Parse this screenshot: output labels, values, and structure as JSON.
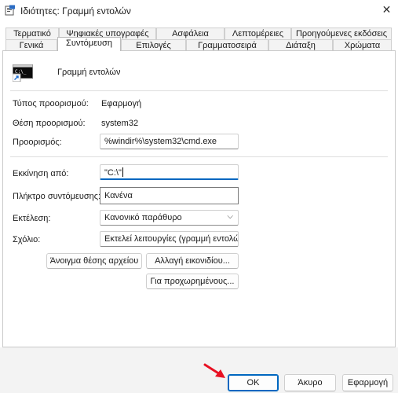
{
  "window": {
    "title": "Ιδιότητες: Γραμμή εντολών",
    "close_symbol": "✕"
  },
  "tabs_row1": [
    {
      "label": "Τερματικό"
    },
    {
      "label": "Ψηφιακές υπογραφές"
    },
    {
      "label": "Ασφάλεια"
    },
    {
      "label": "Λεπτομέρειες"
    },
    {
      "label": "Προηγούμενες εκδόσεις"
    }
  ],
  "tabs_row2": [
    {
      "label": "Γενικά"
    },
    {
      "label": "Συντόμευση",
      "active": true
    },
    {
      "label": "Επιλογές"
    },
    {
      "label": "Γραμματοσειρά"
    },
    {
      "label": "Διάταξη"
    },
    {
      "label": "Χρώματα"
    }
  ],
  "shortcut": {
    "name": "Γραμμή εντολών",
    "icon": "cmd-shortcut-icon"
  },
  "fields": {
    "target_type_label": "Τύπος προορισμού:",
    "target_type_value": "Εφαρμογή",
    "target_location_label": "Θέση προορισμού:",
    "target_location_value": "system32",
    "target_label": "Προορισμός:",
    "target_value": "%windir%\\system32\\cmd.exe",
    "start_in_label": "Εκκίνηση από:",
    "start_in_value": "\"C:\\\"",
    "hotkey_label": "Πλήκτρο συντόμευσης:",
    "hotkey_value": "Κανένα",
    "run_label": "Εκτέλεση:",
    "run_value": "Κανονικό παράθυρο",
    "comment_label": "Σχόλιο:",
    "comment_value": "Εκτελεί λειτουργίες (γραμμή εντολών) π"
  },
  "buttons": {
    "open_location": "Άνοιγμα θέσης αρχείου",
    "change_icon": "Αλλαγή εικονιδίου...",
    "advanced": "Για προχωρημένους..."
  },
  "footer": {
    "ok": "OK",
    "cancel": "Άκυρο",
    "apply": "Εφαρμογή"
  },
  "colors": {
    "accent": "#0067c0",
    "annotation_arrow": "#e81123"
  }
}
